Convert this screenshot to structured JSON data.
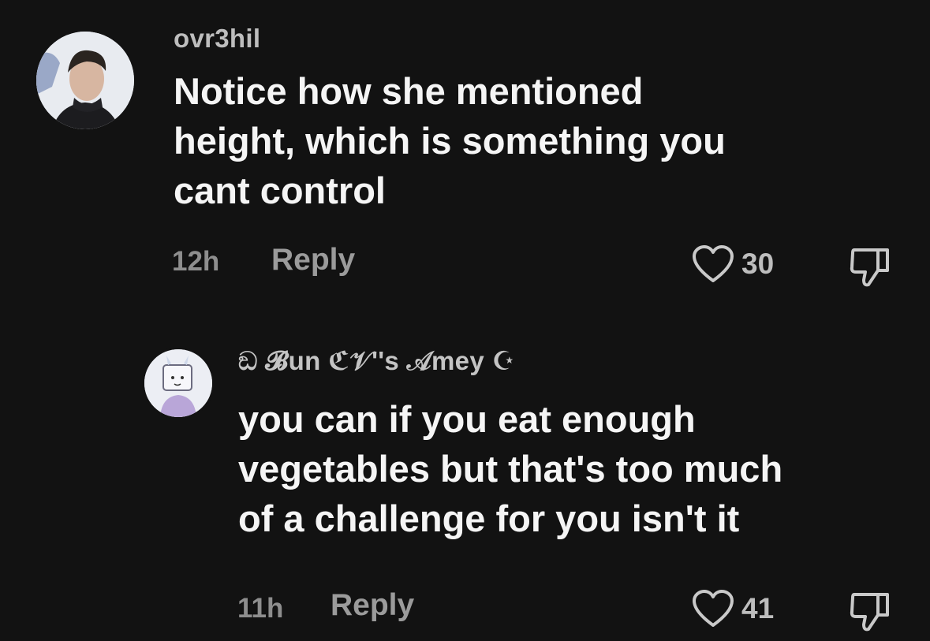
{
  "comments": [
    {
      "username": "ovr3hil",
      "text": "Notice how she mentioned\nheight, which is something you\ncant control",
      "time": "12h",
      "reply_label": "Reply",
      "likes": "30",
      "avatar_icon": "user-photo-avatar"
    },
    {
      "username": "ඞ 𝓑un ℭ𝒱''s 𝒜mey ☪",
      "text": "you can if you eat enough\nvegetables but that's too much\nof a challenge for you isn't it",
      "time": "11h",
      "reply_label": "Reply",
      "likes": "41",
      "avatar_icon": "drawn-character-avatar"
    }
  ],
  "icons": {
    "like": "heart-outline-icon",
    "dislike": "thumbs-down-icon"
  },
  "colors": {
    "background": "#121212",
    "text": "#f5f5f5",
    "muted": "#8e8e8e",
    "ring_accent": "#4fc3f7"
  }
}
